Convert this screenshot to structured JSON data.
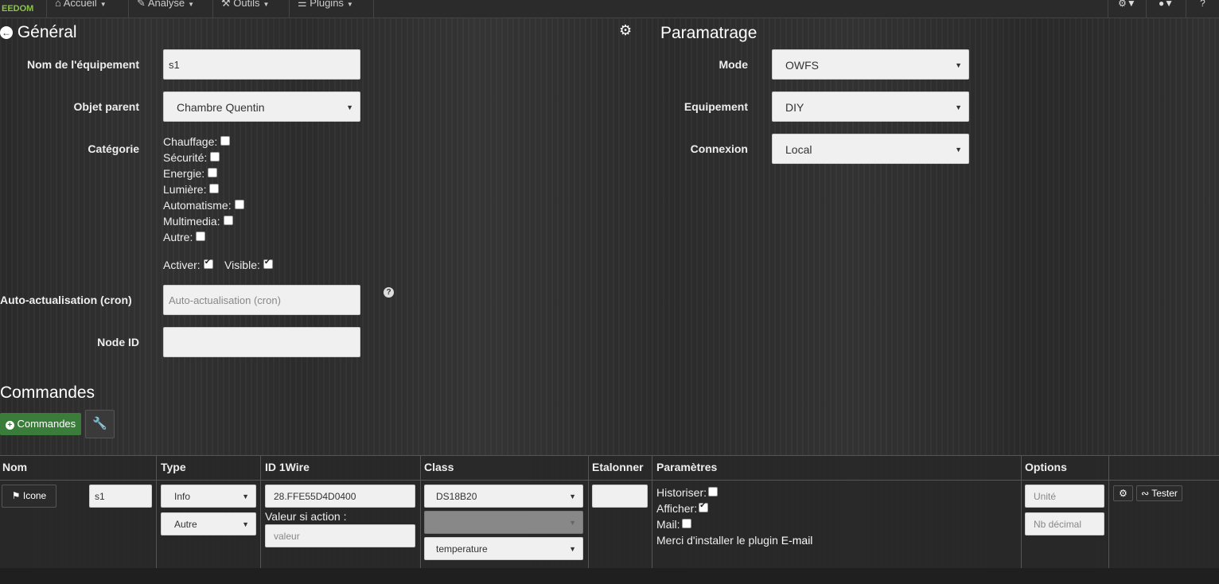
{
  "navbar": {
    "logo": "EEDOM",
    "items": [
      "Accueil",
      "Analyse",
      "Outils",
      "Plugins"
    ]
  },
  "general": {
    "title": "Général",
    "name_label": "Nom de l'équipement",
    "name_value": "s1",
    "parent_label": "Objet parent",
    "parent_value": "Chambre Quentin",
    "category_label": "Catégorie",
    "categories": [
      {
        "label": "Chauffage:",
        "checked": false
      },
      {
        "label": "Sécurité:",
        "checked": false
      },
      {
        "label": "Energie:",
        "checked": false
      },
      {
        "label": "Lumière:",
        "checked": false
      },
      {
        "label": "Automatisme:",
        "checked": false
      },
      {
        "label": "Multimedia:",
        "checked": false
      },
      {
        "label": "Autre:",
        "checked": false
      }
    ],
    "activer_label": "Activer:",
    "visible_label": "Visible:",
    "cron_label": "Auto-actualisation (cron)",
    "cron_placeholder": "Auto-actualisation (cron)",
    "nodeid_label": "Node ID",
    "nodeid_value": ""
  },
  "parametrage": {
    "title": "Paramatrage",
    "mode_label": "Mode",
    "mode_value": "OWFS",
    "equip_label": "Equipement",
    "equip_value": "DIY",
    "connexion_label": "Connexion",
    "connexion_value": "Local"
  },
  "commandes": {
    "title": "Commandes",
    "add_button": "Commandes"
  },
  "table": {
    "headers": [
      "Nom",
      "Type",
      "ID 1Wire",
      "Class",
      "Etalonner",
      "Paramètres",
      "Options"
    ],
    "row": {
      "icon_button": "Icone",
      "name": "s1",
      "type": "Info",
      "subtype": "Autre",
      "id1wire": "28.FFE55D4D0400",
      "valeur_label": "Valeur si action :",
      "valeur_placeholder": "valeur",
      "class": "DS18B20",
      "class2": "",
      "class3": "temperature",
      "etalonner": "",
      "historiser": "Historiser:",
      "afficher": "Afficher:",
      "mail": "Mail:",
      "note_prefix": "Merci d'installer le plugin ",
      "note_plugin": "E-mail",
      "unite_placeholder": "Unité",
      "decimal_placeholder": "Nb décimal",
      "tester": "Tester"
    }
  }
}
